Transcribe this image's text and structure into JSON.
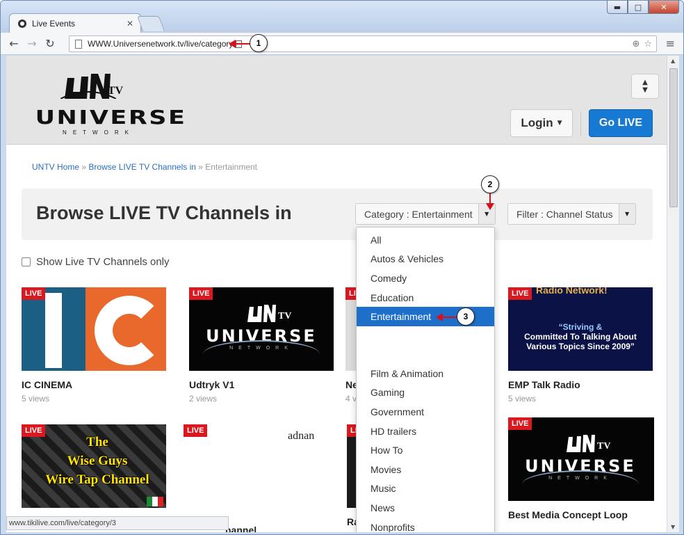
{
  "browser": {
    "tab_title": "Live Events",
    "url": "WWW.Universenetwork.tv/live/category",
    "status_url": "www.tikilive.com/live/category/3",
    "window_controls": {
      "minimize": "▬",
      "maximize": "□",
      "close": "✕"
    }
  },
  "callouts": {
    "one": "1",
    "two": "2",
    "three": "3"
  },
  "site": {
    "logo_main": "UNIVERSE",
    "logo_sub": "NETWORK",
    "logo_tv": "TV",
    "login_label": "Login",
    "golive_label": "Go LIVE"
  },
  "breadcrumb": {
    "home": "UNTV Home",
    "sep1": "»",
    "browse": "Browse LIVE TV Channels in",
    "sep2": "»",
    "current": "Entertainment"
  },
  "browse": {
    "title": "Browse LIVE TV Channels in",
    "category_label": "Category : Entertainment",
    "filter_label": "Filter : Channel Status",
    "show_live_label": "Show Live TV Channels only"
  },
  "category_menu": {
    "items_top": [
      "All",
      "Autos & Vehicles",
      "Comedy",
      "Education",
      "Entertainment"
    ],
    "active": "Entertainment",
    "items_bottom": [
      "Film & Animation",
      "Gaming",
      "Government",
      "HD trailers",
      "How To",
      "Movies",
      "Music",
      "News",
      "Nonprofits"
    ]
  },
  "channels": [
    {
      "title": "IC CINEMA",
      "views": "5 views",
      "badge": "LIVE"
    },
    {
      "title": "Udtryk V1",
      "views": "2 views",
      "badge": "LIVE",
      "thumb_main": "UNIVERSE",
      "thumb_sub": "NETWORK",
      "thumb_tv": "TV"
    },
    {
      "title": "Ne",
      "views": "4 v",
      "badge": "LIVE"
    },
    {
      "title": "EMP Talk Radio",
      "views": "5 views",
      "badge": "LIVE",
      "thumb_top": "Radio Network!",
      "quote1": "“Striving &",
      "quote2": "Committed To Talking About",
      "quote3": "Various Topics Since 2009”"
    },
    {
      "title": "",
      "views": "",
      "badge": "LIVE",
      "line1": "The",
      "line2": "Wise Guys",
      "line3": "Wire Tap Channel"
    },
    {
      "title": "nannel",
      "views": "",
      "badge": "LIVE",
      "thumb_text": "adnan"
    },
    {
      "title": "Ra",
      "views": "",
      "badge": "LIVE"
    },
    {
      "title": "Best Media Concept Loop",
      "views": "",
      "badge": "LIVE",
      "thumb_main": "UNIVERSE",
      "thumb_sub": "NETWORK",
      "thumb_tv": "TV"
    }
  ]
}
